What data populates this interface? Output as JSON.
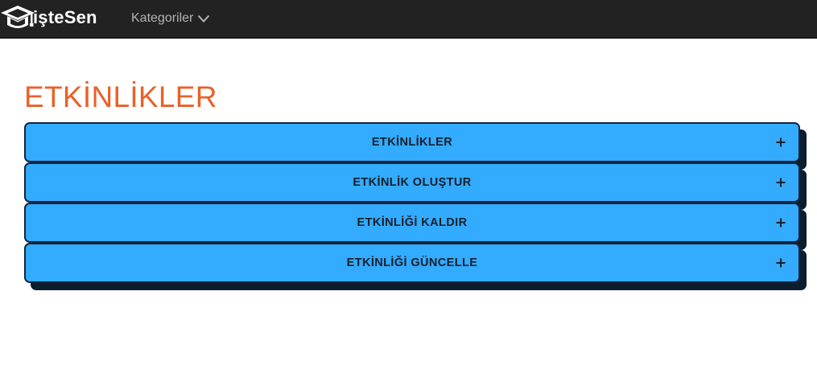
{
  "navbar": {
    "brand": "işteSen",
    "logo_icon": "graduation-cap-icon",
    "menu": {
      "label": "Kategoriler",
      "icon": "chevron-down-icon"
    },
    "colors": {
      "background": "#222222",
      "brand_text": "#ffffff",
      "menu_text": "#b4b4b4"
    }
  },
  "page": {
    "title": "ETKİNLİKLER",
    "title_color": "#e8622a"
  },
  "accordion": {
    "expand_icon": "plus-icon",
    "colors": {
      "panel_bg": "#33abff",
      "panel_border": "#12263d",
      "shadow": "#0b1d2f",
      "text": "#161f2b"
    },
    "panels": [
      {
        "label": "ETKİNLİKLER",
        "expanded": false
      },
      {
        "label": "ETKİNLİK OLUŞTUR",
        "expanded": false
      },
      {
        "label": "ETKİNLİĞİ KALDIR",
        "expanded": false
      },
      {
        "label": "ETKİNLİĞİ GÜNCELLE",
        "expanded": false
      }
    ]
  }
}
